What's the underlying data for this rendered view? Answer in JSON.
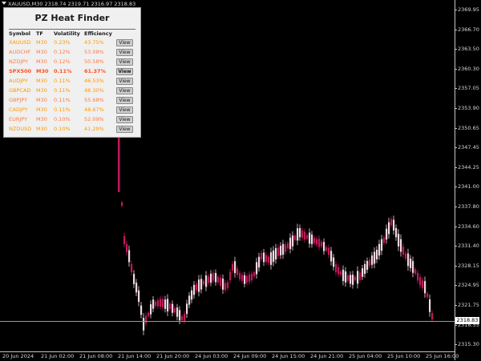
{
  "chart_header": "XAUUSD,M30  2318.74 2319.71 2316.97 2318.83",
  "price_axis": [
    "2369.95",
    "2366.70",
    "2363.50",
    "2360.30",
    "2357.05",
    "2353.90",
    "2350.65",
    "2347.45",
    "2344.25",
    "2341.00",
    "2337.80",
    "2334.60",
    "2331.40",
    "2328.15",
    "2324.95",
    "2321.75",
    "2318.55",
    "2315.30"
  ],
  "time_axis": [
    "20 Jun 2024",
    "21 Jun 02:00",
    "21 Jun 08:00",
    "21 Jun 14:00",
    "21 Jun 20:00",
    "24 Jun 03:00",
    "24 Jun 09:00",
    "24 Jun 15:00",
    "24 Jun 21:00",
    "25 Jun 04:00",
    "25 Jun 10:00",
    "25 Jun 16:00"
  ],
  "current_price": "2318.83",
  "candle_colors": {
    "bull": "#f0d8e0",
    "bear": "#c2185b"
  },
  "panel": {
    "title": "PZ Heat Finder",
    "headers": {
      "symbol": "Symbol",
      "tf": "TF",
      "volatility": "Volatility",
      "efficiency": "Efficiency"
    },
    "view_label": "View",
    "rows": [
      {
        "symbol": "XAUUSD",
        "tf": "M30",
        "volatility": "0.23%",
        "efficiency": "43.75%",
        "color": "#ff9800",
        "bold": false
      },
      {
        "symbol": "AUDCHF",
        "tf": "M30",
        "volatility": "0.12%",
        "efficiency": "53.08%",
        "color": "#ff7a45",
        "bold": false
      },
      {
        "symbol": "NZDJPY",
        "tf": "M30",
        "volatility": "0.12%",
        "efficiency": "50.58%",
        "color": "#ff7a45",
        "bold": false
      },
      {
        "symbol": "SPX500",
        "tf": "M30",
        "volatility": "0.11%",
        "efficiency": "61.37%",
        "color": "#ff4f1f",
        "bold": true
      },
      {
        "symbol": "AUDJPY",
        "tf": "M30",
        "volatility": "0.11%",
        "efficiency": "46.53%",
        "color": "#ff9800",
        "bold": false
      },
      {
        "symbol": "GBPCAD",
        "tf": "M30",
        "volatility": "0.11%",
        "efficiency": "48.30%",
        "color": "#ff9800",
        "bold": false
      },
      {
        "symbol": "GBPJPY",
        "tf": "M30",
        "volatility": "0.11%",
        "efficiency": "55.68%",
        "color": "#ff7a45",
        "bold": false
      },
      {
        "symbol": "CADJPY",
        "tf": "M30",
        "volatility": "0.11%",
        "efficiency": "48.67%",
        "color": "#ff9800",
        "bold": false
      },
      {
        "symbol": "EURJPY",
        "tf": "M30",
        "volatility": "0.10%",
        "efficiency": "52.09%",
        "color": "#ff7a45",
        "bold": false
      },
      {
        "symbol": "NZDUSD",
        "tf": "M30",
        "volatility": "0.10%",
        "efficiency": "41.29%",
        "color": "#ff9800",
        "bold": false
      }
    ]
  }
}
